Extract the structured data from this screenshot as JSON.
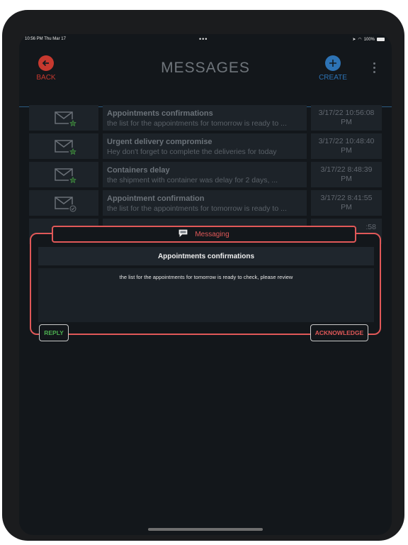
{
  "status_bar": {
    "time": "10:56 PM   Thu Mar 17",
    "dots": "•••",
    "battery": "100%"
  },
  "header": {
    "back_label": "BACK",
    "title": "MESSAGES",
    "create_label": "CREATE"
  },
  "messages": [
    {
      "title": "Appointments confirmations",
      "preview": "the list for the appointments for tomorrow is ready to ...",
      "date": "3/17/22 10:56:08",
      "time_suffix": "PM",
      "badge": "star"
    },
    {
      "title": "Urgent delivery compromise",
      "preview": "Hey don't forget to complete the deliveries for today",
      "date": "3/17/22 10:48:40",
      "time_suffix": "PM",
      "badge": "star"
    },
    {
      "title": "Containers delay",
      "preview": "the shipment  with container was delay for 2 days, ...",
      "date": "3/17/22 8:48:39",
      "time_suffix": "PM",
      "badge": "star"
    },
    {
      "title": "Appointment confirmation",
      "preview": "the list for the appointments for tomorrow is ready to ...",
      "date": "3/17/22 8:41:55",
      "time_suffix": "PM",
      "badge": "check"
    },
    {
      "title": "",
      "preview": "",
      "date": ":58",
      "time_suffix": "",
      "badge": ""
    }
  ],
  "dialog": {
    "tab_label": "Messaging",
    "title": "Appointments confirmations",
    "body": "the list for the appointments for tomorrow is ready to check, please review",
    "reply_label": "REPLY",
    "acknowledge_label": "ACKNOWLEDGE"
  },
  "colors": {
    "accent_red": "#e05858",
    "accent_blue": "#2d73b5",
    "accent_green": "#4caf50",
    "back_red": "#c7392f"
  }
}
